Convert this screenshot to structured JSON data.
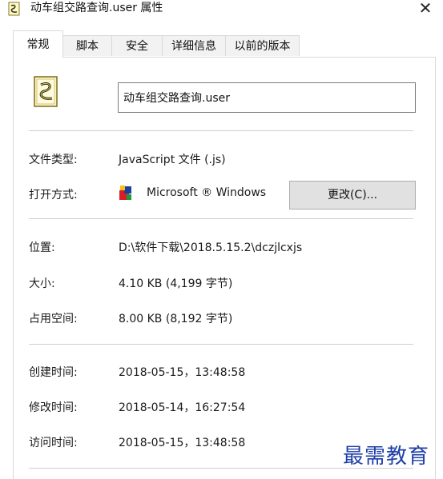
{
  "window": {
    "title": "动车组交路查询.user 属性",
    "close_glyph": "✕"
  },
  "tabs": [
    {
      "label": "常规",
      "active": true
    },
    {
      "label": "脚本",
      "active": false
    },
    {
      "label": "安全",
      "active": false
    },
    {
      "label": "详细信息",
      "active": false
    },
    {
      "label": "以前的版本",
      "active": false
    }
  ],
  "general": {
    "filename": "动车组交路查询.user",
    "file_type": {
      "label": "文件类型:",
      "value": "JavaScript 文件 (.js)"
    },
    "opens_with": {
      "label": "打开方式:",
      "value": "Microsoft ® Windows",
      "change_button": "更改(C)..."
    },
    "location": {
      "label": "位置:",
      "value": "D:\\软件下载\\2018.5.15.2\\dczjlcxjs"
    },
    "size": {
      "label": "大小:",
      "value": "4.10 KB (4,199 字节)"
    },
    "size_on_disk": {
      "label": "占用空间:",
      "value": "8.00 KB (8,192 字节)"
    },
    "created": {
      "label": "创建时间:",
      "value": "2018-05-15，13:48:58"
    },
    "modified": {
      "label": "修改时间:",
      "value": "2018-05-14，16:27:54"
    },
    "accessed": {
      "label": "访问时间:",
      "value": "2018-05-15，13:48:58"
    }
  },
  "watermark": "最需教育",
  "icons": {
    "title": "script-file-icon",
    "file": "script-file-icon",
    "app": "windows-script-host-icon",
    "close": "close-icon"
  }
}
